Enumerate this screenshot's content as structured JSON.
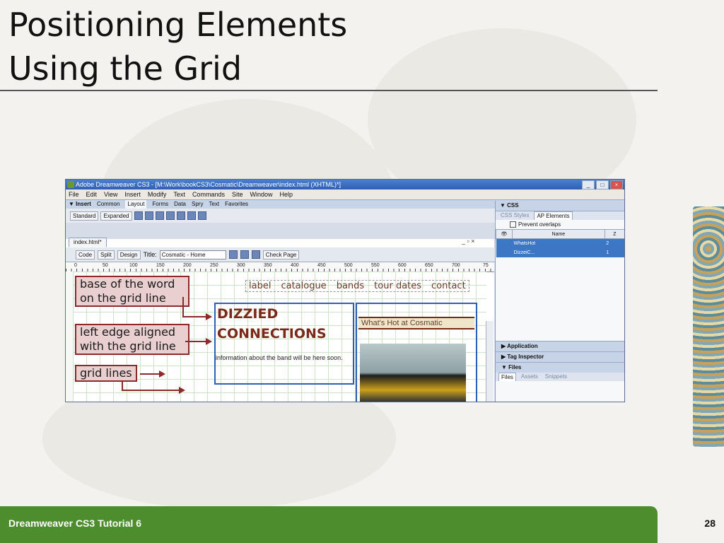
{
  "slide": {
    "title_line1": "Positioning Elements",
    "title_line2": "Using the Grid",
    "footer": "Dreamweaver CS3 Tutorial 6",
    "page_number": "28"
  },
  "window": {
    "title": "Adobe Dreamweaver CS3 - [M:\\Work\\bookCS3\\Cosmatic\\Dreamweaver\\index.html (XHTML)*]",
    "menu": [
      "File",
      "Edit",
      "View",
      "Insert",
      "Modify",
      "Text",
      "Commands",
      "Site",
      "Window",
      "Help"
    ],
    "insert_label": "▼ Insert",
    "insert_tabs": [
      "Common",
      "Layout",
      "Forms",
      "Data",
      "Spry",
      "Text",
      "Favorites"
    ],
    "mode_buttons": [
      "Standard",
      "Expanded"
    ],
    "doc_tab": "index.html*",
    "view_buttons": [
      "Code",
      "Split",
      "Design"
    ],
    "title_label": "Title:",
    "title_value": "Cosmatic - Home",
    "check_page": "Check Page",
    "ruler_ticks": [
      "0",
      "50",
      "100",
      "150",
      "200",
      "250",
      "300",
      "350",
      "400",
      "450",
      "500",
      "550",
      "600",
      "650",
      "700",
      "75"
    ]
  },
  "design_view": {
    "nav_links": [
      "label",
      "catalogue",
      "bands",
      "tour dates",
      "contact"
    ],
    "dizzied_line1": "DIZZIED",
    "dizzied_line2": "CONNECTIONS",
    "info": "information about the band will be here soon.",
    "whats_hot": "What's Hot at Cosmatic"
  },
  "callouts": {
    "base": "base of the word on the grid line",
    "left_edge": "left edge aligned with the grid line",
    "grid_lines": "grid lines"
  },
  "panels": {
    "css_head": "▼ CSS",
    "css_tabs": [
      "CSS Styles",
      "AP Elements"
    ],
    "prevent_overlaps": "Prevent overlaps",
    "table_headers": [
      "Name",
      "Z"
    ],
    "rows": [
      {
        "name": "WhatsHot",
        "z": "2"
      },
      {
        "name": "DizzeiC...",
        "z": "1"
      }
    ],
    "application": "▶ Application",
    "tag_inspector": "▶ Tag Inspector",
    "files": "▼ Files",
    "files_tabs": [
      "Files",
      "Assets",
      "Snippets"
    ]
  }
}
